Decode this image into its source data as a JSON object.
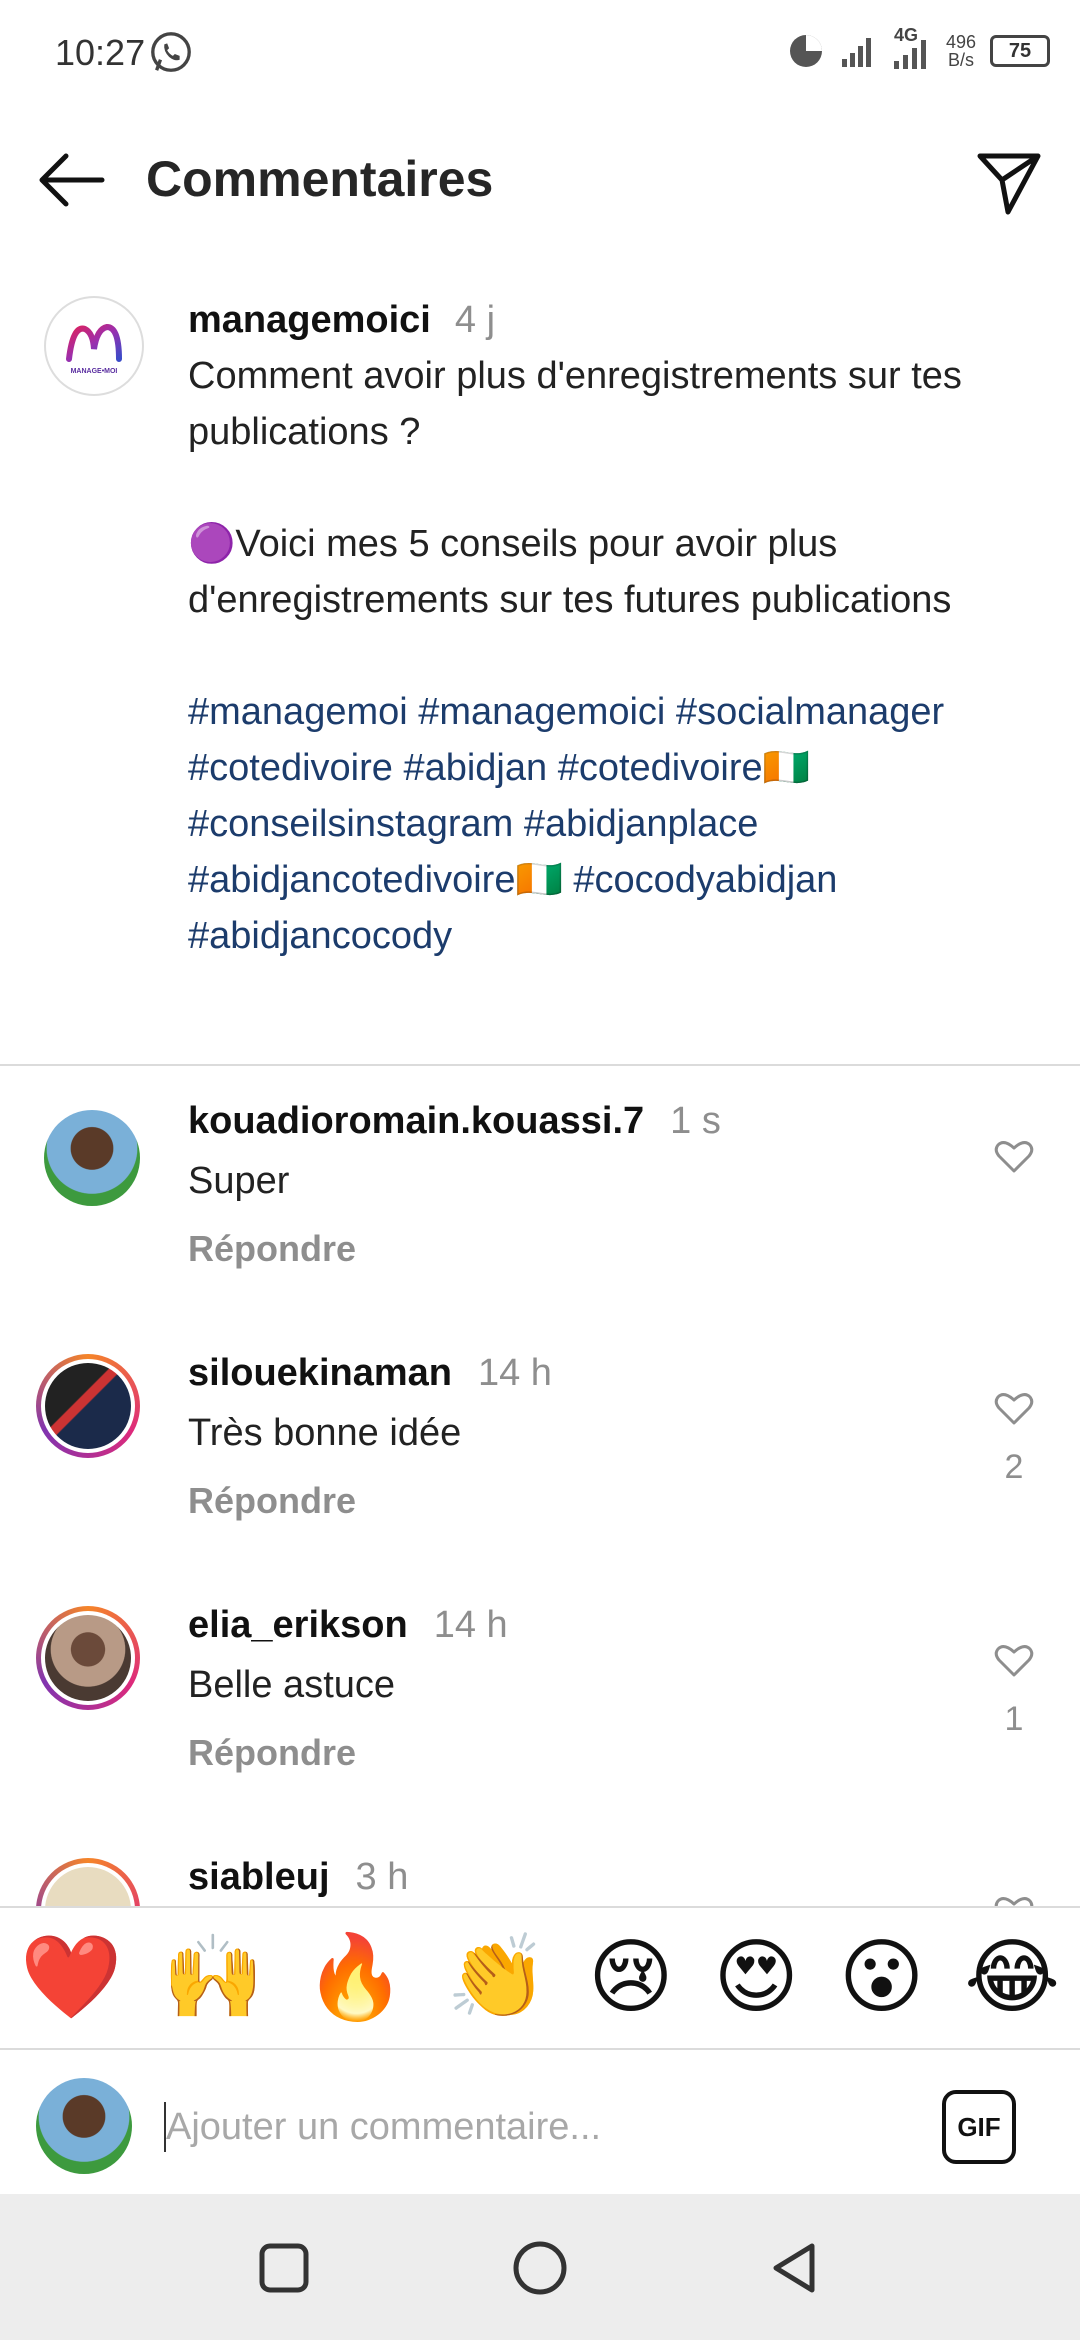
{
  "status_bar": {
    "time": "10:27",
    "network_type": "4G",
    "speed_value": "496",
    "speed_unit": "B/s",
    "battery": "75"
  },
  "header": {
    "title": "Commentaires"
  },
  "caption": {
    "username": "managemoici",
    "age": "4 j",
    "avatar_logo_text": "MANAGE•MOI",
    "line1": "Comment avoir plus d'enregistrements sur tes publications ?",
    "line2": "🟣Voici mes 5 conseils pour avoir plus d'enregistrements sur tes futures publications",
    "hashtags": "#managemoi #managemoici #socialmanager #cotedivoire #abidjan #cotedivoire🇨🇮 #conseilsinstagram #abidjanplace #abidjancotedivoire🇨🇮 #cocodyabidjan #abidjancocody"
  },
  "comments": [
    {
      "username": "kouadioromain.kouassi.7",
      "age": "1 s",
      "text": "Super",
      "reply": "Répondre",
      "likes": ""
    },
    {
      "username": "silouekinaman",
      "age": "14 h",
      "text": "Très bonne idée",
      "reply": "Répondre",
      "likes": "2"
    },
    {
      "username": "elia_erikson",
      "age": "14 h",
      "text": "Belle astuce",
      "reply": "Répondre",
      "likes": "1"
    },
    {
      "username": "siableuj",
      "age": "3 h",
      "text": "",
      "reply": "",
      "likes": ""
    }
  ],
  "emoji_bar": [
    "❤️",
    "🙌",
    "🔥",
    "👏",
    "😢",
    "😍",
    "😮",
    "😂"
  ],
  "input": {
    "placeholder": "Ajouter un commentaire...",
    "gif_label": "GIF"
  },
  "colors": {
    "hashtag": "#1c3c6c",
    "muted": "#8e8e8e",
    "divider": "#dbdbdb"
  }
}
